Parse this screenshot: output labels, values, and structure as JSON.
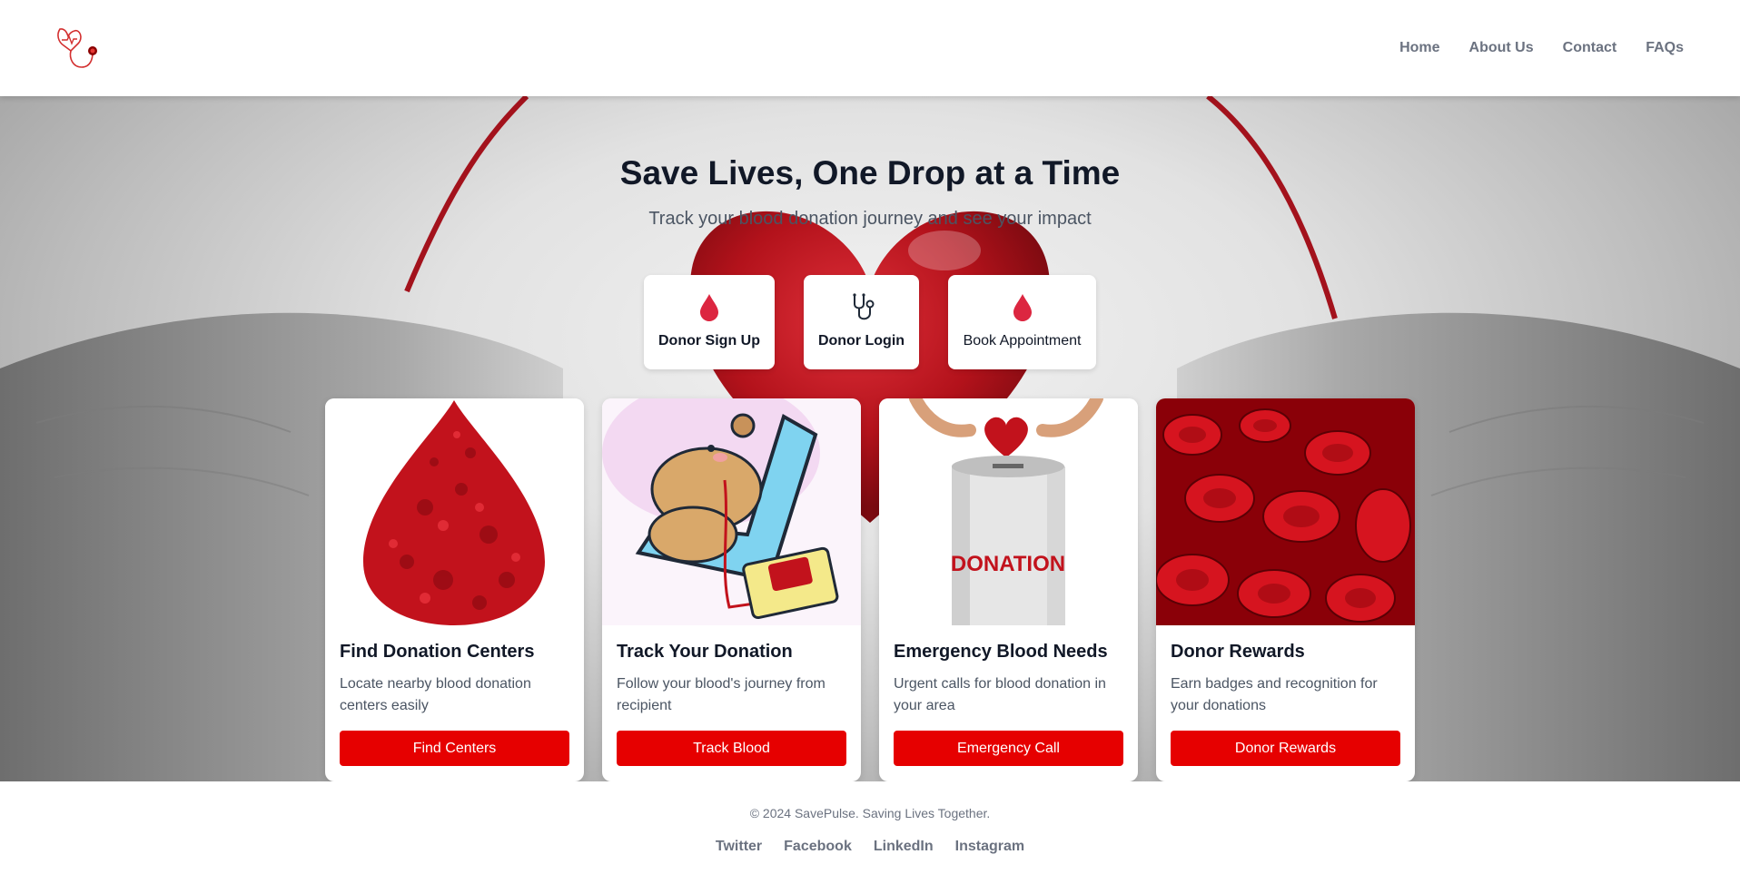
{
  "header": {
    "logo": "stethoscope-heart-logo",
    "nav": [
      {
        "label": "Home"
      },
      {
        "label": "About Us"
      },
      {
        "label": "Contact"
      },
      {
        "label": "FAQs"
      }
    ]
  },
  "hero": {
    "title": "Save Lives, One Drop at a Time",
    "subtitle": "Track your blood donation journey and see your impact",
    "actions": [
      {
        "label": "Donor Sign Up",
        "icon": "blood-drop-icon"
      },
      {
        "label": "Donor Login",
        "icon": "stethoscope-icon"
      },
      {
        "label": "Book Appointment",
        "icon": "blood-drop-icon"
      }
    ]
  },
  "cards": [
    {
      "title": "Find Donation Centers",
      "description": "Locate nearby blood donation centers easily",
      "button": "Find Centers",
      "image": "blood-drop-image"
    },
    {
      "title": "Track Your Donation",
      "description": "Follow your blood's journey from recipient",
      "button": "Track Blood",
      "image": "capybara-donating-image"
    },
    {
      "title": "Emergency Blood Needs",
      "description": "Urgent calls for blood donation in your area",
      "button": "Emergency Call",
      "image": "donation-can-image"
    },
    {
      "title": "Donor Rewards",
      "description": "Earn badges and recognition for your donations",
      "button": "Donor Rewards",
      "image": "red-blood-cells-image"
    }
  ],
  "image_text": {
    "donation_can": "DONATION"
  },
  "footer": {
    "copyright": "© 2024 SavePulse. Saving Lives Together.",
    "social": [
      {
        "label": "Twitter"
      },
      {
        "label": "Facebook"
      },
      {
        "label": "LinkedIn"
      },
      {
        "label": "Instagram"
      }
    ]
  },
  "colors": {
    "accent": "#e60000",
    "drop": "#dc2640",
    "heading": "#111827",
    "muted": "#6b7280"
  }
}
